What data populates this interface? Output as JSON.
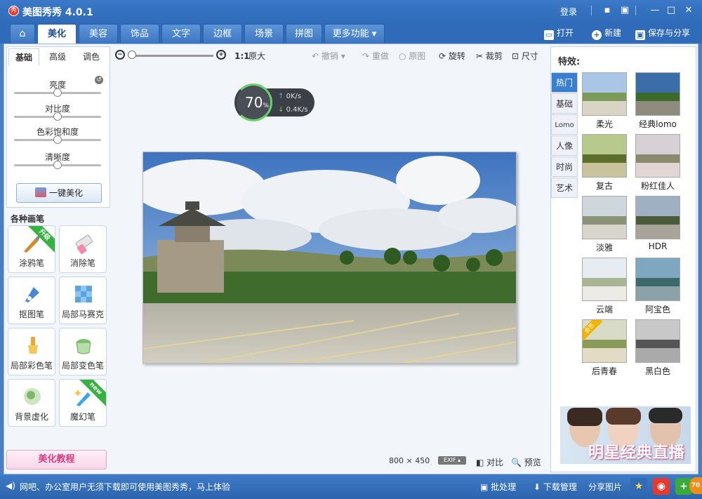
{
  "app": {
    "title": "美图秀秀 4.0.1",
    "logo_text": "秀"
  },
  "titlebar": {
    "login": "登录"
  },
  "tabs": [
    {
      "label": "⌂"
    },
    {
      "label": "美化"
    },
    {
      "label": "美容"
    },
    {
      "label": "饰品"
    },
    {
      "label": "文字"
    },
    {
      "label": "边框"
    },
    {
      "label": "场景"
    },
    {
      "label": "拼图"
    },
    {
      "label": "更多功能 ▾"
    }
  ],
  "top_actions": {
    "open": "打开",
    "new": "新建",
    "save_share": "保存与分享"
  },
  "left": {
    "subtabs": [
      "基础",
      "高级",
      "调色"
    ],
    "sliders": [
      {
        "label": "亮度",
        "value": 50
      },
      {
        "label": "对比度",
        "value": 50
      },
      {
        "label": "色彩饱和度",
        "value": 50
      },
      {
        "label": "清晰度",
        "value": 50
      }
    ],
    "one_key": "一键美化",
    "brushes_title": "各种画笔",
    "brushes": [
      {
        "label": "涂鸦笔",
        "ribbon": "升级"
      },
      {
        "label": "消除笔",
        "ribbon": ""
      },
      {
        "label": "抠图笔",
        "ribbon": ""
      },
      {
        "label": "局部马赛克",
        "ribbon": ""
      },
      {
        "label": "局部彩色笔",
        "ribbon": ""
      },
      {
        "label": "局部变色笔",
        "ribbon": ""
      },
      {
        "label": "背景虚化",
        "ribbon": ""
      },
      {
        "label": "魔幻笔",
        "ribbon": "new"
      }
    ],
    "tutorial": "美化教程"
  },
  "canvas_toolbar": {
    "actual_size_prefix": "1:1",
    "actual_size": "原大",
    "undo": "撤销",
    "redo": "重做",
    "original": "原图",
    "rotate": "旋转",
    "crop": "裁剪",
    "size": "尺寸",
    "zoom_level": 0
  },
  "speed": {
    "percent": "70",
    "pct_sign": "%",
    "up": "0K/s",
    "down": "0.4K/s"
  },
  "image_info": {
    "width": "800",
    "x": "×",
    "height": "450",
    "exif": "EXIF ▴",
    "compare": "对比",
    "preview": "预览"
  },
  "right": {
    "title": "特效:",
    "categories": [
      "热门",
      "基础",
      "Lomo",
      "人像",
      "时尚",
      "艺术"
    ],
    "effects": [
      {
        "name": "柔光"
      },
      {
        "name": "经典lomo"
      },
      {
        "name": "复古"
      },
      {
        "name": "粉红佳人"
      },
      {
        "name": "淡雅"
      },
      {
        "name": "HDR"
      },
      {
        "name": "云端"
      },
      {
        "name": "阿宝色"
      },
      {
        "name": "后青春",
        "vip": "会员"
      },
      {
        "name": "黑白色"
      }
    ],
    "ad_text": "明星经典直播"
  },
  "bottombar": {
    "message": "网吧、办公室用户无须下载即可使用美图秀秀，马上体验",
    "batch": "批处理",
    "download_mgr": "下载管理",
    "share": "分享图片",
    "badge": "70"
  },
  "colors": {
    "accent": "#2f6bb8",
    "active_tab": "#3a7fd0",
    "ribbon_green": "#37b13f"
  }
}
